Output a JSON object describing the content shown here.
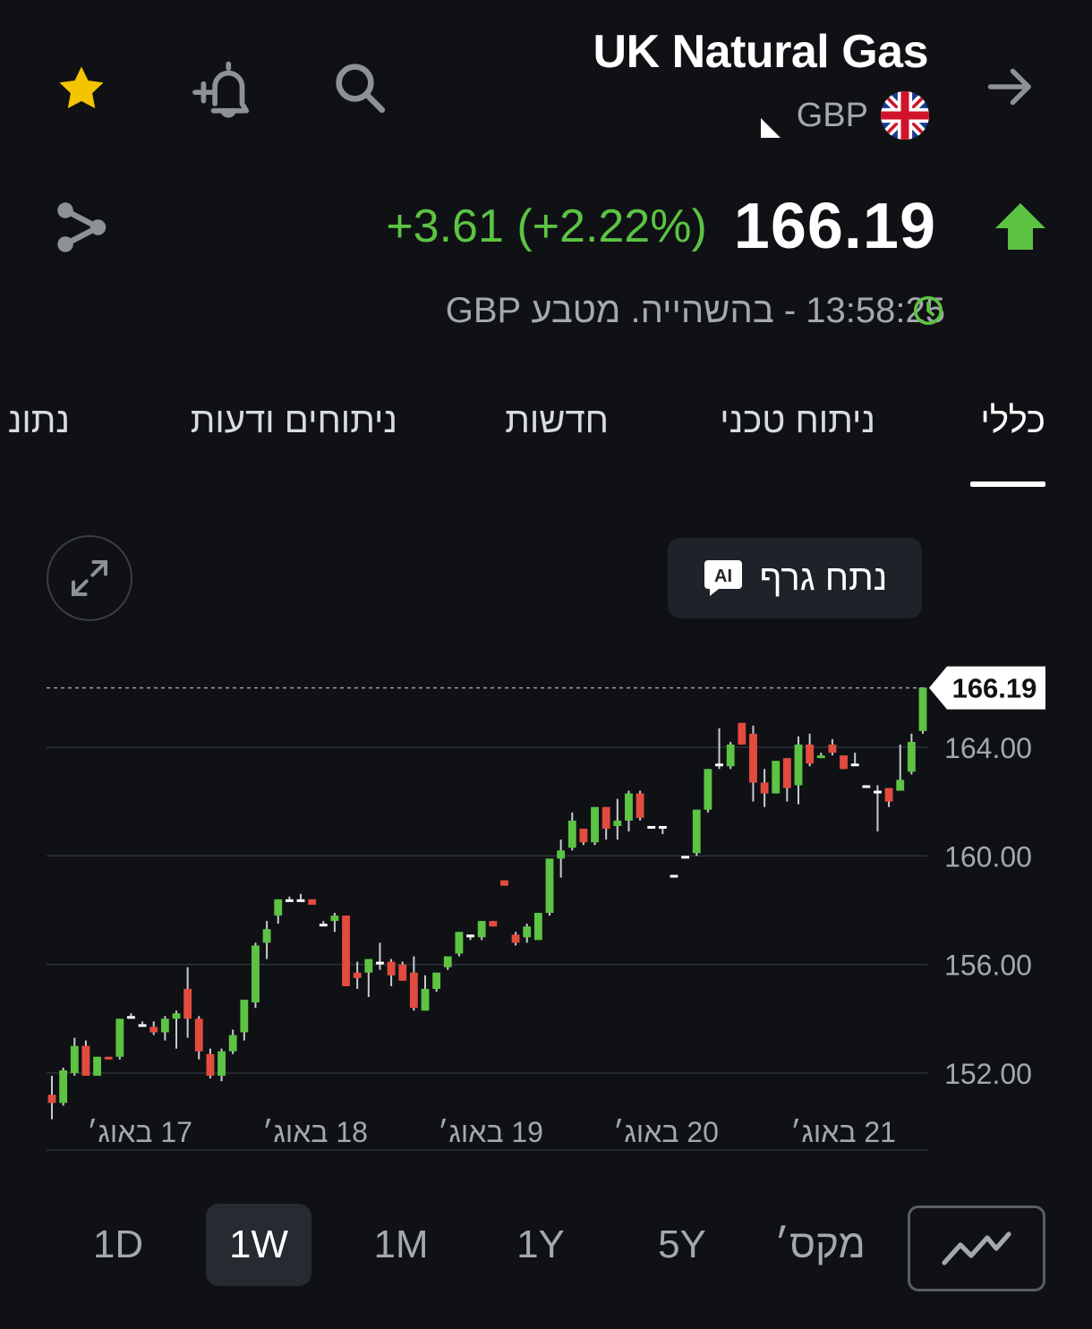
{
  "header": {
    "title": "UK Natural Gas",
    "currency": "GBP",
    "icons": [
      "star-icon",
      "add-alert-icon",
      "search-icon",
      "forward-arrow-icon",
      "share-icon",
      "uk-flag-icon"
    ]
  },
  "quote": {
    "price": "166.19",
    "change": "+3.61 (+2.22%)",
    "direction": "up",
    "time_text": "13:58:25 - בהשהייה. מטבע GBP",
    "colors": {
      "up": "#5cc343",
      "down": "#e24b3e"
    }
  },
  "tabs": [
    {
      "label": "כללי",
      "active": true
    },
    {
      "label": "ניתוח טכני",
      "active": false
    },
    {
      "label": "חדשות",
      "active": false
    },
    {
      "label": "ניתוחים ודעות",
      "active": false
    },
    {
      "label": "נתונ",
      "active": false
    }
  ],
  "ai_button": {
    "label": "נתח גרף",
    "badge": "AI"
  },
  "chart_data": {
    "type": "candlestick",
    "y_ticks": [
      "164.00",
      "160.00",
      "156.00",
      "152.00"
    ],
    "x_ticks": [
      "17 באוג׳",
      "18 באוג׳",
      "19 באוג׳",
      "20 באוג׳",
      "21 באוג׳"
    ],
    "ylim": [
      149.5,
      166.8
    ],
    "last_price_label": "166.19",
    "last_price": 166.19,
    "grid": true,
    "candles": [
      [
        151.2,
        151.9,
        150.3,
        150.9
      ],
      [
        150.9,
        152.2,
        150.8,
        152.1
      ],
      [
        152.0,
        153.3,
        151.9,
        153.0
      ],
      [
        153.0,
        153.2,
        152.2,
        151.9
      ],
      [
        151.9,
        152.6,
        152.2,
        152.6
      ],
      [
        152.6,
        152.6,
        152.6,
        152.5
      ],
      [
        152.6,
        154.0,
        152.5,
        154.0
      ],
      [
        154.1,
        154.2,
        154.1,
        154.1
      ],
      [
        153.8,
        153.9,
        153.8,
        153.8
      ],
      [
        153.7,
        153.9,
        153.4,
        153.5
      ],
      [
        153.5,
        154.1,
        153.2,
        154.0
      ],
      [
        154.0,
        154.3,
        152.9,
        154.2
      ],
      [
        155.1,
        155.9,
        153.3,
        154.0
      ],
      [
        154.0,
        154.1,
        152.5,
        152.8
      ],
      [
        152.7,
        152.9,
        151.8,
        151.9
      ],
      [
        151.9,
        152.9,
        151.7,
        152.8
      ],
      [
        152.8,
        153.6,
        152.7,
        153.4
      ],
      [
        153.5,
        154.6,
        153.2,
        154.7
      ],
      [
        154.6,
        156.8,
        154.4,
        156.7
      ],
      [
        156.8,
        157.6,
        156.2,
        157.3
      ],
      [
        157.8,
        158.4,
        157.5,
        158.4
      ],
      [
        158.4,
        158.5,
        158.4,
        158.4
      ],
      [
        158.4,
        158.6,
        158.4,
        158.4
      ],
      [
        158.4,
        158.4,
        158.2,
        158.2
      ],
      [
        157.5,
        157.6,
        157.5,
        157.5
      ],
      [
        157.6,
        157.9,
        157.2,
        157.8
      ],
      [
        157.8,
        157.8,
        155.2,
        155.2
      ],
      [
        155.7,
        156.1,
        155.1,
        155.5
      ],
      [
        155.7,
        156.2,
        154.8,
        156.2
      ],
      [
        156.1,
        156.8,
        155.8,
        156.1
      ],
      [
        156.1,
        156.2,
        155.2,
        155.6
      ],
      [
        156.0,
        156.1,
        155.5,
        155.4
      ],
      [
        155.7,
        156.3,
        154.3,
        154.4
      ],
      [
        154.3,
        155.6,
        154.4,
        155.1
      ],
      [
        155.1,
        155.7,
        155.0,
        155.7
      ],
      [
        155.9,
        156.1,
        155.8,
        156.3
      ],
      [
        156.4,
        156.5,
        156.3,
        157.2
      ],
      [
        157.1,
        157.1,
        156.9,
        157.1
      ],
      [
        157.0,
        157.5,
        156.9,
        157.6
      ],
      [
        157.6,
        157.6,
        157.4,
        157.4
      ],
      [
        159.1,
        159.0,
        158.9,
        158.9
      ],
      [
        157.1,
        157.2,
        156.7,
        156.8
      ],
      [
        157.0,
        157.5,
        156.8,
        157.4
      ],
      [
        156.9,
        157.9,
        156.9,
        157.9
      ],
      [
        157.9,
        159.8,
        157.8,
        159.9
      ],
      [
        159.9,
        160.6,
        159.2,
        160.2
      ],
      [
        160.3,
        161.6,
        160.2,
        161.3
      ],
      [
        161.0,
        160.9,
        160.4,
        160.5
      ],
      [
        160.5,
        161.8,
        160.4,
        161.8
      ],
      [
        161.8,
        161.8,
        160.6,
        161.0
      ],
      [
        161.1,
        162.1,
        160.6,
        161.3
      ],
      [
        161.3,
        162.4,
        160.9,
        162.3
      ],
      [
        162.3,
        162.4,
        161.3,
        161.4
      ],
      [
        161.1,
        161.1,
        161.1,
        161.1
      ],
      [
        161.1,
        161.1,
        160.8,
        161.1
      ],
      [
        159.3,
        159.3,
        159.3,
        159.3
      ],
      [
        160.0,
        160.0,
        160.0,
        160.0
      ],
      [
        160.1,
        161.7,
        160.0,
        161.7
      ],
      [
        161.7,
        163.2,
        161.6,
        163.2
      ],
      [
        163.4,
        164.7,
        163.2,
        163.4
      ],
      [
        163.3,
        164.2,
        163.2,
        164.1
      ],
      [
        164.9,
        164.9,
        164.5,
        164.1
      ],
      [
        164.5,
        164.8,
        162.0,
        162.7
      ],
      [
        162.7,
        163.2,
        161.8,
        162.3
      ],
      [
        162.3,
        163.4,
        162.3,
        163.5
      ],
      [
        163.6,
        163.6,
        162.0,
        162.5
      ],
      [
        162.6,
        164.4,
        161.9,
        164.1
      ],
      [
        164.1,
        164.5,
        163.3,
        163.4
      ],
      [
        163.6,
        163.8,
        163.7,
        163.7
      ],
      [
        164.1,
        164.3,
        163.7,
        163.8
      ],
      [
        163.7,
        163.7,
        163.2,
        163.2
      ],
      [
        163.4,
        163.8,
        163.4,
        163.4
      ],
      [
        162.6,
        162.6,
        162.6,
        162.6
      ],
      [
        162.4,
        162.6,
        160.9,
        162.4
      ],
      [
        162.5,
        162.5,
        161.8,
        162.0
      ],
      [
        162.4,
        164.1,
        162.9,
        162.8
      ],
      [
        163.1,
        164.5,
        163.0,
        164.2
      ],
      [
        164.6,
        165.2,
        164.5,
        166.2
      ]
    ]
  },
  "ranges": [
    {
      "label": "1D",
      "active": false
    },
    {
      "label": "1W",
      "active": true
    },
    {
      "label": "1M",
      "active": false
    },
    {
      "label": "1Y",
      "active": false
    },
    {
      "label": "5Y",
      "active": false
    },
    {
      "label": "מקס׳",
      "active": false
    }
  ]
}
